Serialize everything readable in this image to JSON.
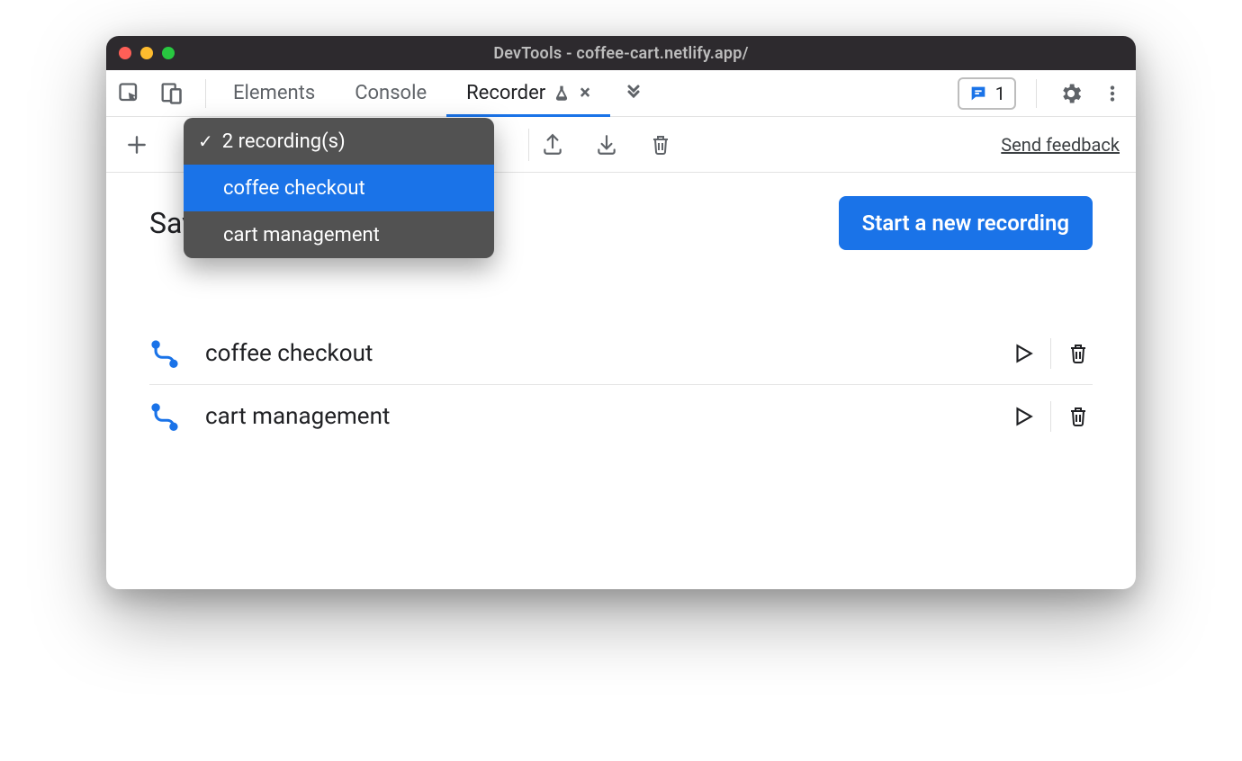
{
  "window": {
    "title": "DevTools - coffee-cart.netlify.app/"
  },
  "tabs": {
    "elements": "Elements",
    "console": "Console",
    "recorder": "Recorder"
  },
  "issues": {
    "count": "1"
  },
  "toolbar": {
    "feedback": "Send feedback"
  },
  "dropdown": {
    "header": "2 recording(s)",
    "items": [
      "coffee checkout",
      "cart management"
    ],
    "selectedIndex": 0
  },
  "page": {
    "heading": "Saved recordings",
    "start_btn": "Start a new recording"
  },
  "recordings": [
    {
      "name": "coffee checkout"
    },
    {
      "name": "cart management"
    }
  ]
}
